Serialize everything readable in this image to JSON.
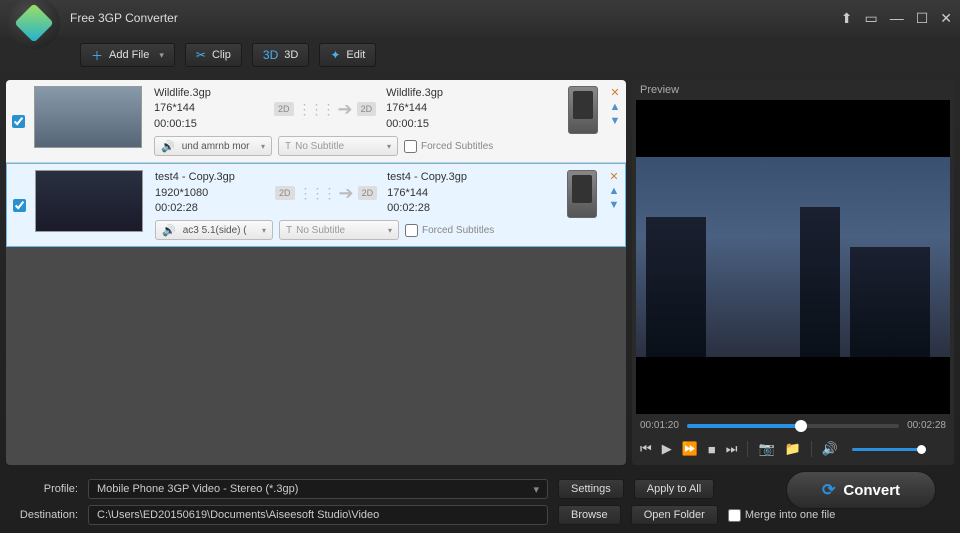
{
  "header": {
    "title": "Free 3GP Converter"
  },
  "toolbar": {
    "add_file": "Add File",
    "clip": "Clip",
    "three_d": "3D",
    "edit": "Edit"
  },
  "labels": {
    "forced_subtitles": "Forced Subtitles"
  },
  "files": [
    {
      "src_name": "Wildlife.3gp",
      "src_res": "176*144",
      "src_dur": "00:00:15",
      "dst_name": "Wildlife.3gp",
      "dst_res": "176*144",
      "dst_dur": "00:00:15",
      "audio": "und amrnb mor",
      "sub": "No Subtitle",
      "checked": true
    },
    {
      "src_name": "test4 - Copy.3gp",
      "src_res": "1920*1080",
      "src_dur": "00:02:28",
      "dst_name": "test4 - Copy.3gp",
      "dst_res": "176*144",
      "dst_dur": "00:02:28",
      "audio": "ac3 5.1(side) (",
      "sub": "No Subtitle",
      "checked": true
    }
  ],
  "preview": {
    "label": "Preview",
    "current": "00:01:20",
    "total": "00:02:28"
  },
  "bottom": {
    "profile_label": "Profile:",
    "profile_value": "Mobile Phone 3GP Video - Stereo (*.3gp)",
    "settings": "Settings",
    "apply_all": "Apply to All",
    "dest_label": "Destination:",
    "dest_value": "C:\\Users\\ED20150619\\Documents\\Aiseesoft Studio\\Video",
    "browse": "Browse",
    "open_folder": "Open Folder",
    "merge": "Merge into one file",
    "convert": "Convert"
  }
}
